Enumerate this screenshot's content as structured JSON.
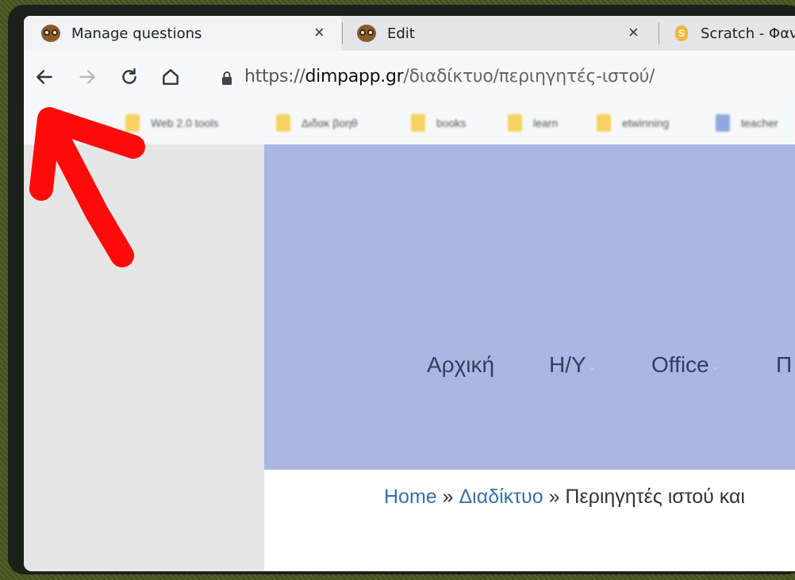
{
  "tabs": [
    {
      "title": "Manage questions",
      "icon": "owl-icon",
      "active": true
    },
    {
      "title": "Edit",
      "icon": "owl-icon",
      "active": false
    },
    {
      "title": "Scratch - Φαν",
      "icon": "scratch-icon",
      "active": false
    }
  ],
  "toolbar": {
    "url_scheme": "https://",
    "url_domain": "dimpapp.gr",
    "url_path": "/διαδίκτυο/περιηγητές-ιστού/"
  },
  "bookmarks": [
    {
      "label": "Web 2.0 tools",
      "icon": "folder-icon"
    },
    {
      "label": "Διδακ βοηθ",
      "icon": "folder-icon"
    },
    {
      "label": "books",
      "icon": "folder-icon"
    },
    {
      "label": "learn",
      "icon": "folder-icon"
    },
    {
      "label": "etwinning",
      "icon": "folder-icon"
    },
    {
      "label": "teacher",
      "icon": "grid-icon"
    }
  ],
  "site_menu": [
    {
      "label": "Αρχική",
      "has_dropdown": false
    },
    {
      "label": "Η/Υ",
      "has_dropdown": true
    },
    {
      "label": "Office",
      "has_dropdown": true
    },
    {
      "label": "Π",
      "has_dropdown": false
    }
  ],
  "breadcrumb": {
    "home": "Home",
    "sep1": " » ",
    "section": "Διαδίκτυο",
    "sep2": " » ",
    "current": "Περιηγητές ιστού και"
  },
  "colors": {
    "hero_bg": "#aab7e4",
    "sidebar_bg": "#e6e6e6",
    "annotation_arrow": "#ff0a0a",
    "link": "#3b6fa8"
  },
  "annotation": {
    "type": "arrow",
    "points_to": "back-button"
  }
}
